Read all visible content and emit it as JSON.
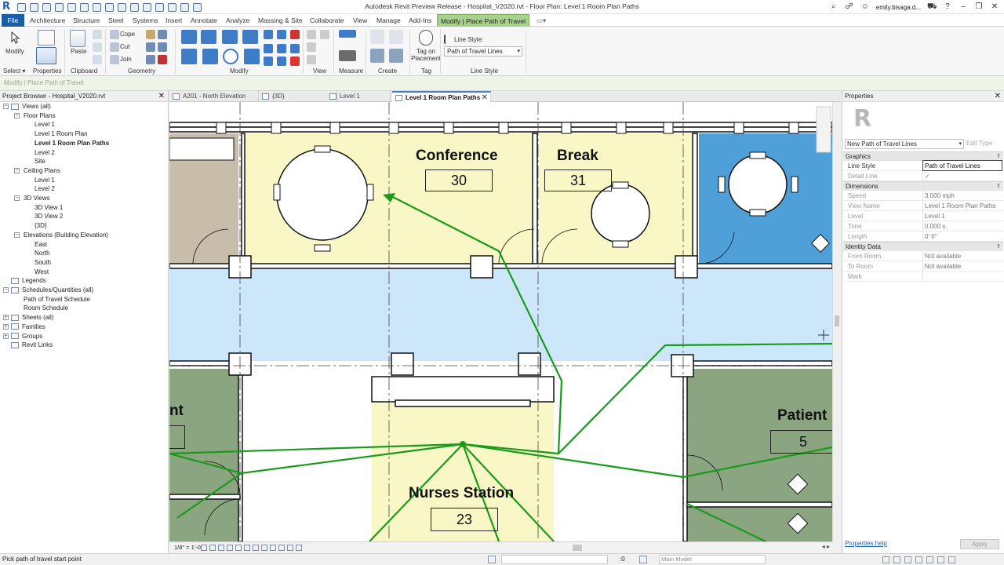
{
  "app_title": "Autodesk Revit Preview Release - Hospital_V2020.rvt - Floor Plan: Level 1 Room Plan Paths",
  "user": "emily.bisaga.d...",
  "ribbon_tabs": [
    "File",
    "Architecture",
    "Structure",
    "Steel",
    "Systems",
    "Insert",
    "Annotate",
    "Analyze",
    "Massing & Site",
    "Collaborate",
    "View",
    "Manage",
    "Add-Ins",
    "Modify | Place Path of Travel"
  ],
  "ribbon": {
    "modify": "Modify",
    "paste": "Paste",
    "cope": "Cope",
    "cut": "Cut",
    "join": "Join",
    "tag_on_placement": "Tag on Placement",
    "line_style_label": "Line Style:",
    "line_style_value": "Path of Travel Lines",
    "panels": {
      "select": "Select",
      "properties": "Properties",
      "clipboard": "Clipboard",
      "geometry": "Geometry",
      "modify": "Modify",
      "view": "View",
      "measure": "Measure",
      "create": "Create",
      "tag": "Tag",
      "line_style": "Line Style"
    }
  },
  "context_bar": "Modify | Place Path of Travel",
  "project_browser": {
    "title": "Project Browser - Hospital_V2020.rvt",
    "items": [
      {
        "label": "Views (all)"
      },
      {
        "label": "Floor Plans"
      },
      {
        "label": "Level 1"
      },
      {
        "label": "Level 1 Room Plan"
      },
      {
        "label": "Level 1 Room Plan Paths"
      },
      {
        "label": "Level 2"
      },
      {
        "label": "Site"
      },
      {
        "label": "Ceiling Plans"
      },
      {
        "label": "Level 1"
      },
      {
        "label": "Level 2"
      },
      {
        "label": "3D Views"
      },
      {
        "label": "3D View 1"
      },
      {
        "label": "3D View 2"
      },
      {
        "label": "{3D}"
      },
      {
        "label": "Elevations (Building Elevation)"
      },
      {
        "label": "East"
      },
      {
        "label": "North"
      },
      {
        "label": "South"
      },
      {
        "label": "West"
      },
      {
        "label": "Legends"
      },
      {
        "label": "Schedules/Quantities (all)"
      },
      {
        "label": "Path of Travel Schedule"
      },
      {
        "label": "Room Schedule"
      },
      {
        "label": "Sheets (all)"
      },
      {
        "label": "Families"
      },
      {
        "label": "Groups"
      },
      {
        "label": "Revit Links"
      }
    ]
  },
  "view_tabs": [
    {
      "label": "A201 - North Elevation"
    },
    {
      "label": "{3D}"
    },
    {
      "label": "Level 1"
    },
    {
      "label": "Level 1 Room Plan Paths"
    }
  ],
  "rooms": [
    {
      "name": "Conference",
      "number": "30"
    },
    {
      "name": "Break",
      "number": "31"
    },
    {
      "name": "Nurses Station",
      "number": "23"
    },
    {
      "name": "Patient",
      "number": "5"
    },
    {
      "name": "nt",
      "number": ""
    }
  ],
  "view_scale": "1/8\" = 1'-0\"",
  "properties": {
    "title": "Properties",
    "type_selector": "New Path of Travel Lines",
    "edit_type": "Edit Type",
    "sections": {
      "graphics": "Graphics",
      "dimensions": "Dimensions",
      "identity": "Identity Data"
    },
    "rows": {
      "line_style": {
        "k": "Line Style",
        "v": "Path of Travel Lines"
      },
      "detail_line": {
        "k": "Detail Line",
        "v": "✓"
      },
      "speed": {
        "k": "Speed",
        "v": "3.000 mph"
      },
      "view_name": {
        "k": "View Name",
        "v": "Level 1 Room Plan Paths"
      },
      "level": {
        "k": "Level",
        "v": "Level 1"
      },
      "time": {
        "k": "Time",
        "v": "0.000 s"
      },
      "length": {
        "k": "Length",
        "v": "0'  0\""
      },
      "from_room": {
        "k": "From Room",
        "v": "Not available"
      },
      "to_room": {
        "k": "To Room",
        "v": "Not available"
      },
      "mark": {
        "k": "Mark",
        "v": ""
      }
    },
    "help": "Properties help",
    "apply": "Apply"
  },
  "status": {
    "message": "Pick path of travel start point",
    "zero": ":0",
    "model": "Main Model"
  },
  "colors": {
    "path_green": "#1a9a1a",
    "room_yellow": "#faf7c6",
    "corridor_blue": "#cce6fa",
    "patient_green": "#8aa57f",
    "room_blue": "#4fa0d9",
    "room_tan": "#c8bdab",
    "modify_tab": "#a9d18e"
  }
}
